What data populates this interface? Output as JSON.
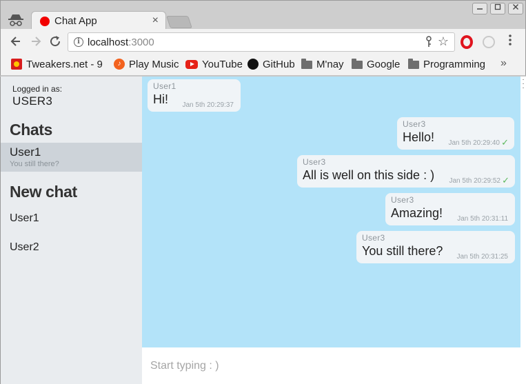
{
  "browser": {
    "tab_title": "Chat App",
    "tab_close": "×",
    "url_host": "localhost",
    "url_port": ":3000",
    "bookmarks": [
      {
        "label": "Tweakers.net - 9",
        "icon": "tweakers-icon"
      },
      {
        "label": "Play Music",
        "icon": "play-music-icon"
      },
      {
        "label": "YouTube",
        "icon": "youtube-icon"
      },
      {
        "label": "GitHub",
        "icon": "github-icon"
      },
      {
        "label": "M'nay",
        "icon": "folder-icon"
      },
      {
        "label": "Google",
        "icon": "folder-icon"
      },
      {
        "label": "Programming",
        "icon": "folder-icon"
      }
    ],
    "bookmarks_more": "»"
  },
  "sidebar": {
    "login_label": "Logged in as:",
    "login_user": "USER3",
    "chats_title": "Chats",
    "chats": [
      {
        "name": "User1",
        "preview": "You still there?"
      }
    ],
    "new_chat_title": "New chat",
    "users": [
      "User1",
      "User2"
    ]
  },
  "messages": [
    {
      "sender": "User1",
      "text": "Hi!",
      "time": "Jan 5th 20:29:37",
      "own": false,
      "check": ""
    },
    {
      "sender": "User3",
      "text": "Hello!",
      "time": "Jan 5th 20:29:40",
      "own": true,
      "check": "✓"
    },
    {
      "sender": "User3",
      "text": "All is well on this side : )",
      "time": "Jan 5th 20:29:52",
      "own": true,
      "check": "✓"
    },
    {
      "sender": "User3",
      "text": "Amazing!",
      "time": "Jan 5th 20:31:11",
      "own": true,
      "check": ""
    },
    {
      "sender": "User3",
      "text": "You still there?",
      "time": "Jan 5th 20:31:25",
      "own": true,
      "check": ""
    }
  ],
  "composer": {
    "placeholder": "Start typing : )"
  },
  "colors": {
    "messages_bg": "#b3e3f9",
    "sidebar_bg": "#e9ecef",
    "active_chat_bg": "#cdd3d9",
    "read_check": "#5cb85c"
  }
}
